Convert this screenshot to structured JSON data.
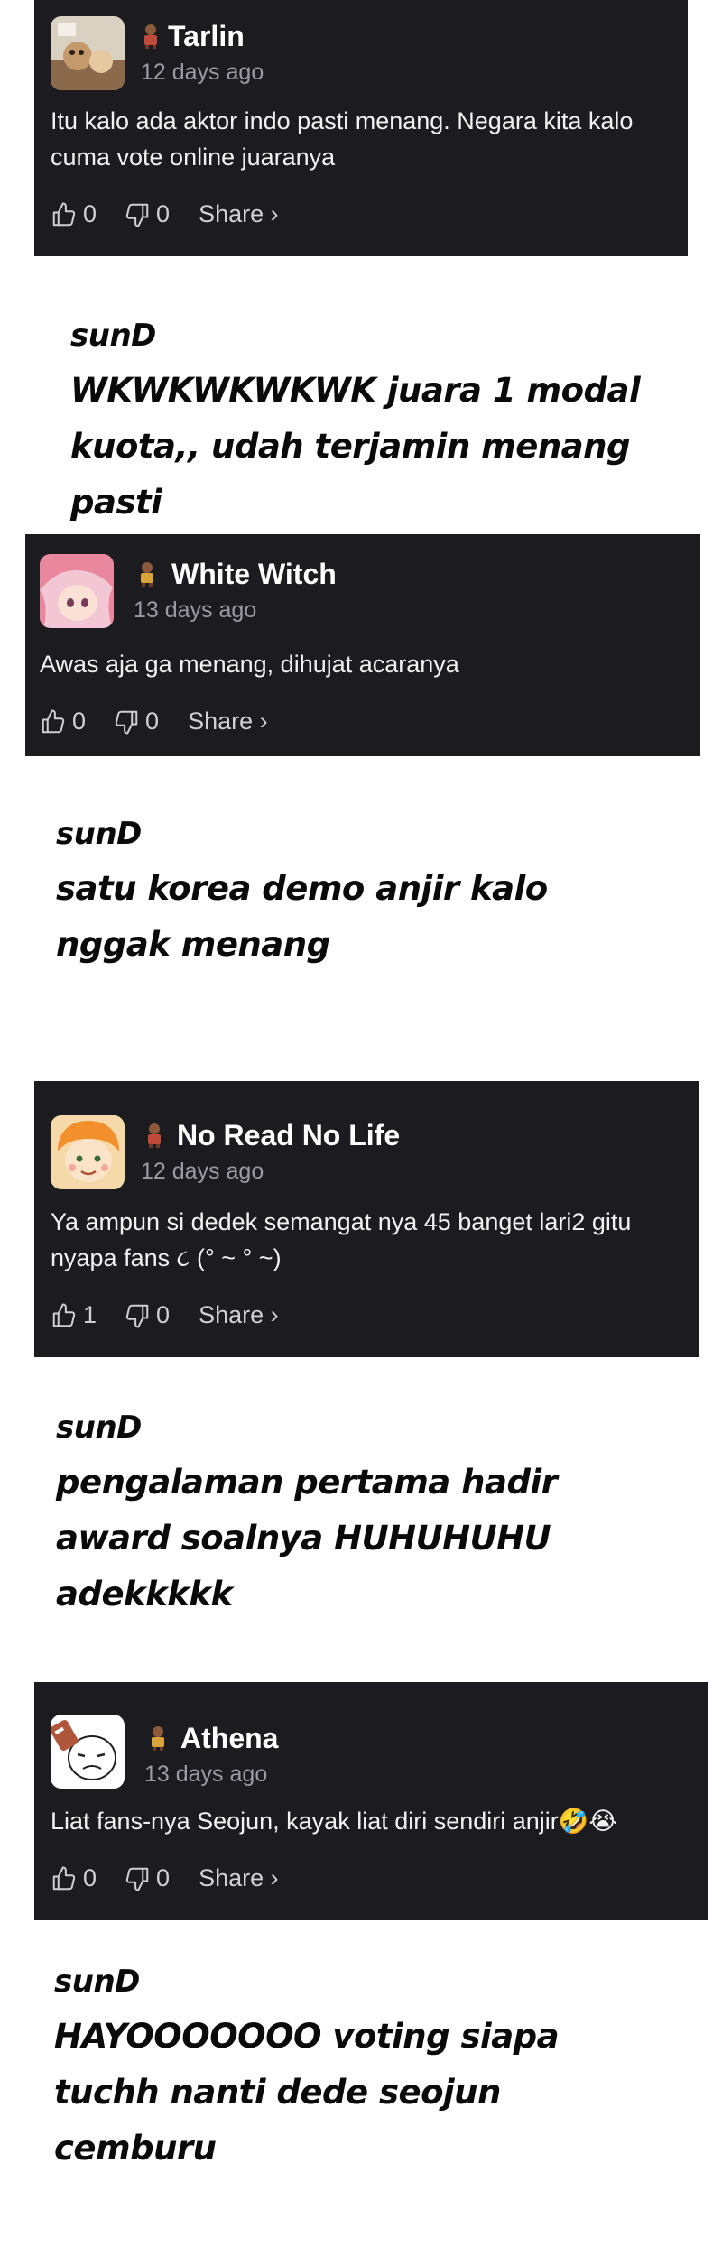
{
  "comments": [
    {
      "username": "Tarlin",
      "timestamp": "12 days ago",
      "text": "Itu kalo ada aktor indo pasti menang. Negara kita kalo cuma vote online juaranya",
      "likes": "0",
      "dislikes": "0",
      "share_label": "Share ›",
      "avatar_icon": "photo-avatar-icon",
      "reply": {
        "author": "sunD",
        "text": "WKWKWKWKWK juara 1 modal kuota,, udah terjamin menang pasti"
      }
    },
    {
      "username": "White Witch",
      "timestamp": "13 days ago",
      "text": "Awas aja ga menang, dihujat acaranya",
      "likes": "0",
      "dislikes": "0",
      "share_label": "Share ›",
      "avatar_icon": "anime-girl-avatar-icon",
      "reply": {
        "author": "sunD",
        "text": "satu korea demo anjir kalo nggak menang"
      }
    },
    {
      "username": "No Read No Life",
      "timestamp": "12 days ago",
      "text": "Ya ampun si dedek semangat nya 45 banget lari2 gitu nyapa fans ૮ (° ~ ° ~)",
      "likes": "1",
      "dislikes": "0",
      "share_label": "Share ›",
      "avatar_icon": "cartoon-boy-avatar-icon",
      "reply": {
        "author": "sunD",
        "text": "pengalaman pertama hadir award soalnya HUHUHUHU adekkkkk"
      }
    },
    {
      "username": "Athena",
      "timestamp": "13 days ago",
      "text": "Liat fans-nya Seojun, kayak liat diri sendiri anjir🤣😭",
      "likes": "0",
      "dislikes": "0",
      "share_label": "Share ›",
      "avatar_icon": "meme-face-avatar-icon",
      "reply": {
        "author": "sunD",
        "text": "HAYOOOOOOO voting siapa tuchh nanti dede seojun cemburu"
      }
    }
  ],
  "colors": {
    "card_bg": "#1c1c20",
    "muted_text": "#9a9aa2",
    "page_bg": "#ffffff"
  }
}
